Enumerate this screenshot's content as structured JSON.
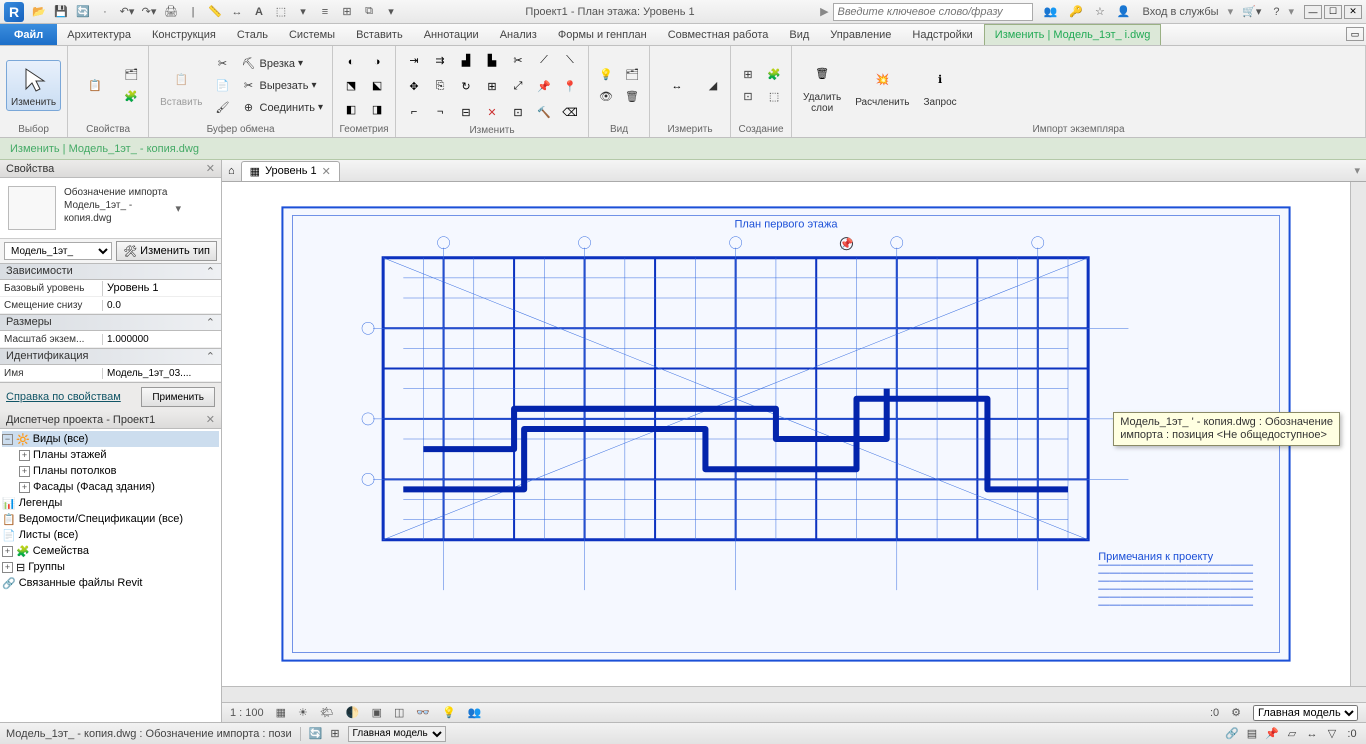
{
  "app": {
    "logo": "R",
    "title": "Проект1 - План этажа: Уровень 1"
  },
  "qat_tips": [
    "Открыть",
    "Сохранить",
    "Синхр.",
    "Отменить",
    "Повторить",
    "Печать"
  ],
  "search": {
    "placeholder": "Введите ключевое слово/фразу"
  },
  "account": {
    "login": "Вход в службы",
    "help": "?"
  },
  "menu": {
    "file": "Файл",
    "tabs": [
      "Архитектура",
      "Конструкция",
      "Сталь",
      "Системы",
      "Вставить",
      "Аннотации",
      "Анализ",
      "Формы и генплан",
      "Совместная работа",
      "Вид",
      "Управление",
      "Надстройки"
    ],
    "active": "Изменить | Модель_1эт_               і.dwg"
  },
  "ribbon": {
    "groups": {
      "select": {
        "label": "Выбор",
        "modify": "Изменить"
      },
      "props": {
        "label": "Свойства"
      },
      "clip": {
        "label": "Буфер обмена",
        "paste": "Вставить",
        "items": [
          "Врезка",
          "Вырезать",
          "Соединить"
        ]
      },
      "geom": {
        "label": "Геометрия"
      },
      "modify": {
        "label": "Изменить"
      },
      "view": {
        "label": "Вид"
      },
      "measure": {
        "label": "Измерить"
      },
      "create": {
        "label": "Создание"
      },
      "import": {
        "label": "Импорт экземпляра",
        "delete": "Удалить\nслои",
        "explode": "Расчленить",
        "query": "Запрос"
      }
    }
  },
  "ctx": "Изменить | Модель_1эт_             - копия.dwg",
  "props": {
    "panel": "Свойства",
    "type_caption": "Обозначение импорта\nМодель_1эт_ -\nкопия.dwg",
    "family_sel": "Модель_1эт_",
    "edit_type": "Изменить тип",
    "sections": {
      "deps": "Зависимости",
      "size": "Размеры",
      "ident": "Идентификация"
    },
    "rows": {
      "base_level_k": "Базовый уровень",
      "base_level_v": "Уровень 1",
      "offset_k": "Смещение снизу",
      "offset_v": "0.0",
      "scale_k": "Масштаб экзем...",
      "scale_v": "1.000000",
      "name_k": "Имя",
      "name_v": "Модель_1эт_03...."
    },
    "help": "Справка по свойствам",
    "apply": "Применить"
  },
  "browser": {
    "title": "Диспетчер проекта - Проект1",
    "nodes": {
      "views": "Виды (все)",
      "floorplans": "Планы этажей",
      "ceilings": "Планы потолков",
      "elev": "Фасады (Фасад здания)",
      "legends": "Легенды",
      "schedules": "Ведомости/Спецификации (все)",
      "sheets": "Листы (все)",
      "families": "Семейства",
      "groups": "Группы",
      "links": "Связанные файлы Revit"
    }
  },
  "viewtab": {
    "icon": "🏠",
    "name": "Уровень 1"
  },
  "tooltip": "Модель_1эт_                     ' - копия.dwg : Обозначение\nимпорта : позиция <Не общедоступное>",
  "viewctrl": {
    "scale": "1 : 100",
    "coord": ":0"
  },
  "status": {
    "left": "Модель_1эт_             - копия.dwg : Обозначение импорта : пози",
    "model": "Главная модель"
  },
  "drawing": {
    "title": "План первого этажа"
  }
}
